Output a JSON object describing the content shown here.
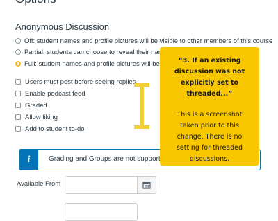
{
  "page": {
    "heading": "Options"
  },
  "anonymous_discussion": {
    "title": "Anonymous Discussion",
    "options": [
      {
        "label": "Off: student names and profile pictures will be visible to other members of this course",
        "selected": false
      },
      {
        "label": "Partial: students can choose to reveal their name and profile picture",
        "selected": false
      },
      {
        "label": "Full: student names and profile pictures will be hidden",
        "selected": true
      }
    ]
  },
  "checkboxes": [
    {
      "label": "Users must post before seeing replies",
      "checked": false
    },
    {
      "label": "Enable podcast feed",
      "checked": false
    },
    {
      "label": "Graded",
      "checked": false
    },
    {
      "label": "Allow liking",
      "checked": false
    },
    {
      "label": "Add to student to-do",
      "checked": false
    }
  ],
  "alert": {
    "icon": "info-icon",
    "icon_glyph": "i",
    "text": "Grading and Groups are not supported in anonymous discussions."
  },
  "available_from": {
    "label": "Available From",
    "value": "",
    "button_icon": "calendar-icon"
  },
  "annotation": {
    "quote": "“3. If an existing discussion was not explicitly set to threaded...”",
    "body": "This is a screenshot taken prior to this change. There is no setting for threaded discussions.",
    "background": "#f8c700"
  },
  "colors": {
    "accent_blue": "#0374b5",
    "selected_radio": "#f2b632",
    "text": "#2d3b45",
    "annotation_yellow": "#f8c700",
    "ibeam_yellow": "#f2cf37"
  }
}
